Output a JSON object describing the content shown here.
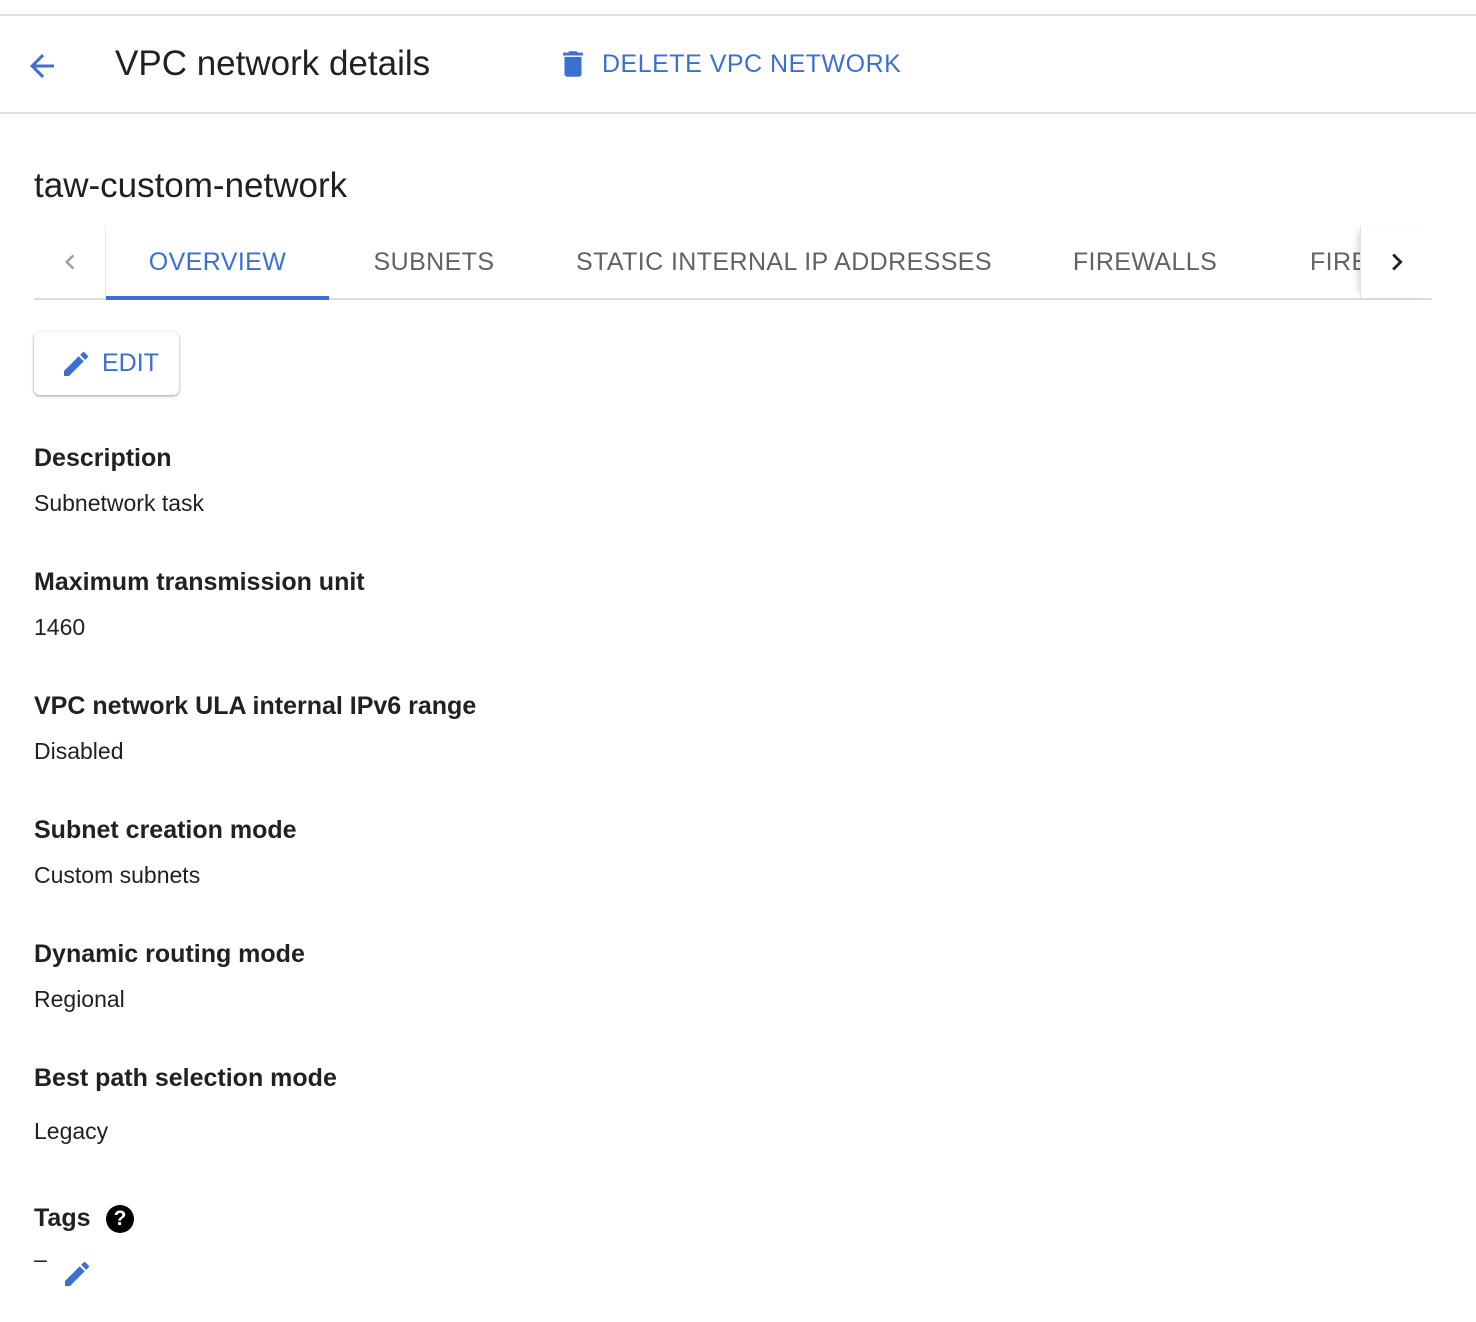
{
  "header": {
    "title": "VPC network details",
    "back_icon": "arrow-back-icon",
    "delete_label": "DELETE VPC NETWORK",
    "delete_icon": "trash-icon"
  },
  "network": {
    "name": "taw-custom-network"
  },
  "tabs": [
    {
      "label": "OVERVIEW",
      "active": true
    },
    {
      "label": "SUBNETS",
      "active": false
    },
    {
      "label": "STATIC INTERNAL IP ADDRESSES",
      "active": false
    },
    {
      "label": "FIREWALLS",
      "active": false
    },
    {
      "label": "FIREWALL",
      "active": false
    }
  ],
  "edit_button": {
    "label": "EDIT",
    "icon": "pencil-icon"
  },
  "fields": [
    {
      "label": "Description",
      "value": "Subnetwork task"
    },
    {
      "label": "Maximum transmission unit",
      "value": "1460"
    },
    {
      "label": "VPC network ULA internal IPv6 range",
      "value": "Disabled"
    },
    {
      "label": "Subnet creation mode",
      "value": "Custom subnets"
    },
    {
      "label": "Dynamic routing mode",
      "value": "Regional"
    },
    {
      "label": "Best path selection mode",
      "value": "Legacy"
    }
  ],
  "tags": {
    "label": "Tags",
    "help_symbol": "?",
    "value": "–"
  },
  "colors": {
    "accent": "#3b6fd4",
    "text": "#202124",
    "muted": "#5f6368",
    "divider": "#e0e0e0"
  }
}
